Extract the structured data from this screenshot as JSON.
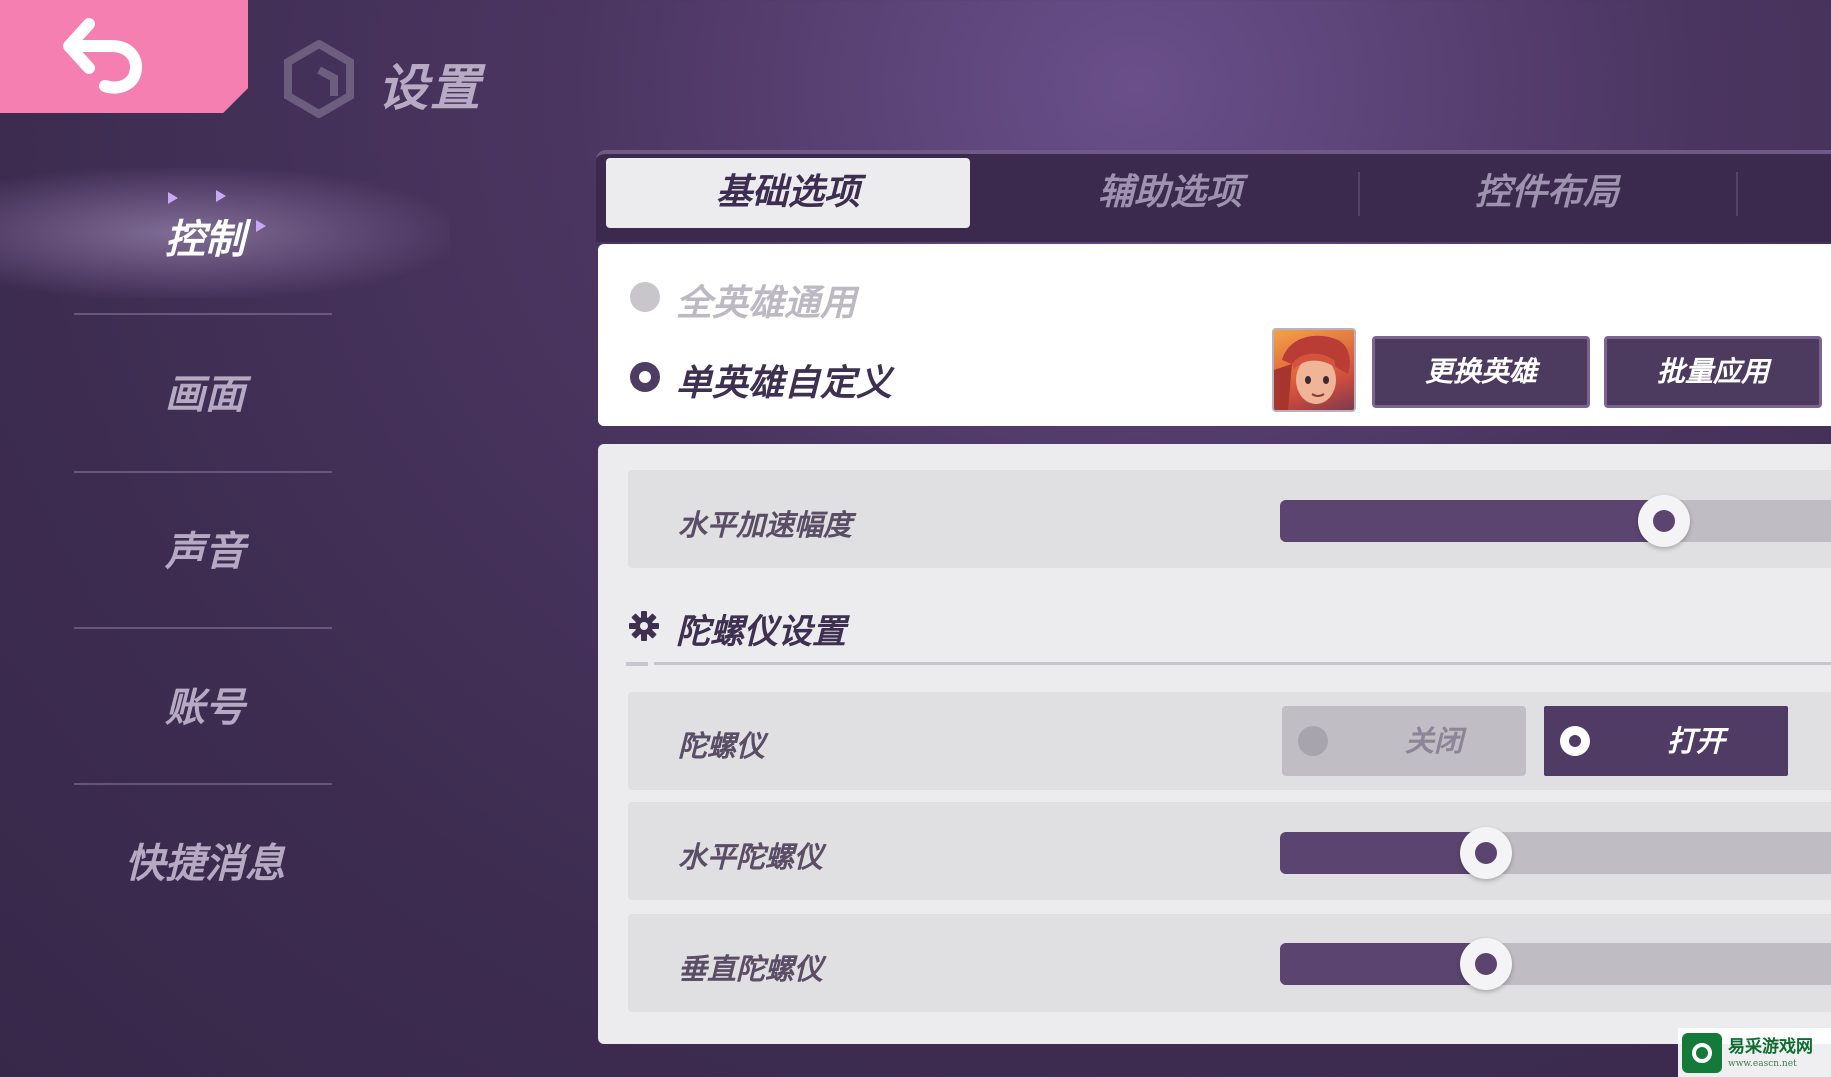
{
  "header": {
    "title": "设置",
    "back_icon": "back-arrow-icon",
    "logo_icon": "cube-logo-icon"
  },
  "sidebar": {
    "items": [
      {
        "label": "控制",
        "active": true
      },
      {
        "label": "画面",
        "active": false
      },
      {
        "label": "声音",
        "active": false
      },
      {
        "label": "账号",
        "active": false
      },
      {
        "label": "快捷消息",
        "active": false
      }
    ]
  },
  "tabs": [
    {
      "label": "基础选项",
      "active": true
    },
    {
      "label": "辅助选项",
      "active": false
    },
    {
      "label": "控件布局",
      "active": false
    }
  ],
  "mode": {
    "options": [
      {
        "label": "全英雄通用",
        "selected": false
      },
      {
        "label": "单英雄自定义",
        "selected": true
      }
    ],
    "change_hero": "更换英雄",
    "batch_apply": "批量应用"
  },
  "settings": {
    "horizontal_accel": {
      "label": "水平加速幅度",
      "value_pct": 69
    },
    "gyro_section": {
      "title": "陀螺仪设置",
      "icon": "gear-icon"
    },
    "gyroscope": {
      "label": "陀螺仪",
      "off_label": "关闭",
      "on_label": "打开",
      "state": "on"
    },
    "horizontal_gyro": {
      "label": "水平陀螺仪",
      "value_pct": 37
    },
    "vertical_gyro": {
      "label": "垂直陀螺仪",
      "value_pct": 37
    }
  },
  "watermark": {
    "name": "易采游戏网",
    "url": "www.eascn.net"
  },
  "colors": {
    "accent_pink": "#f47fb0",
    "primary_purple": "#4f3b63",
    "panel_bg": "#ececee"
  }
}
